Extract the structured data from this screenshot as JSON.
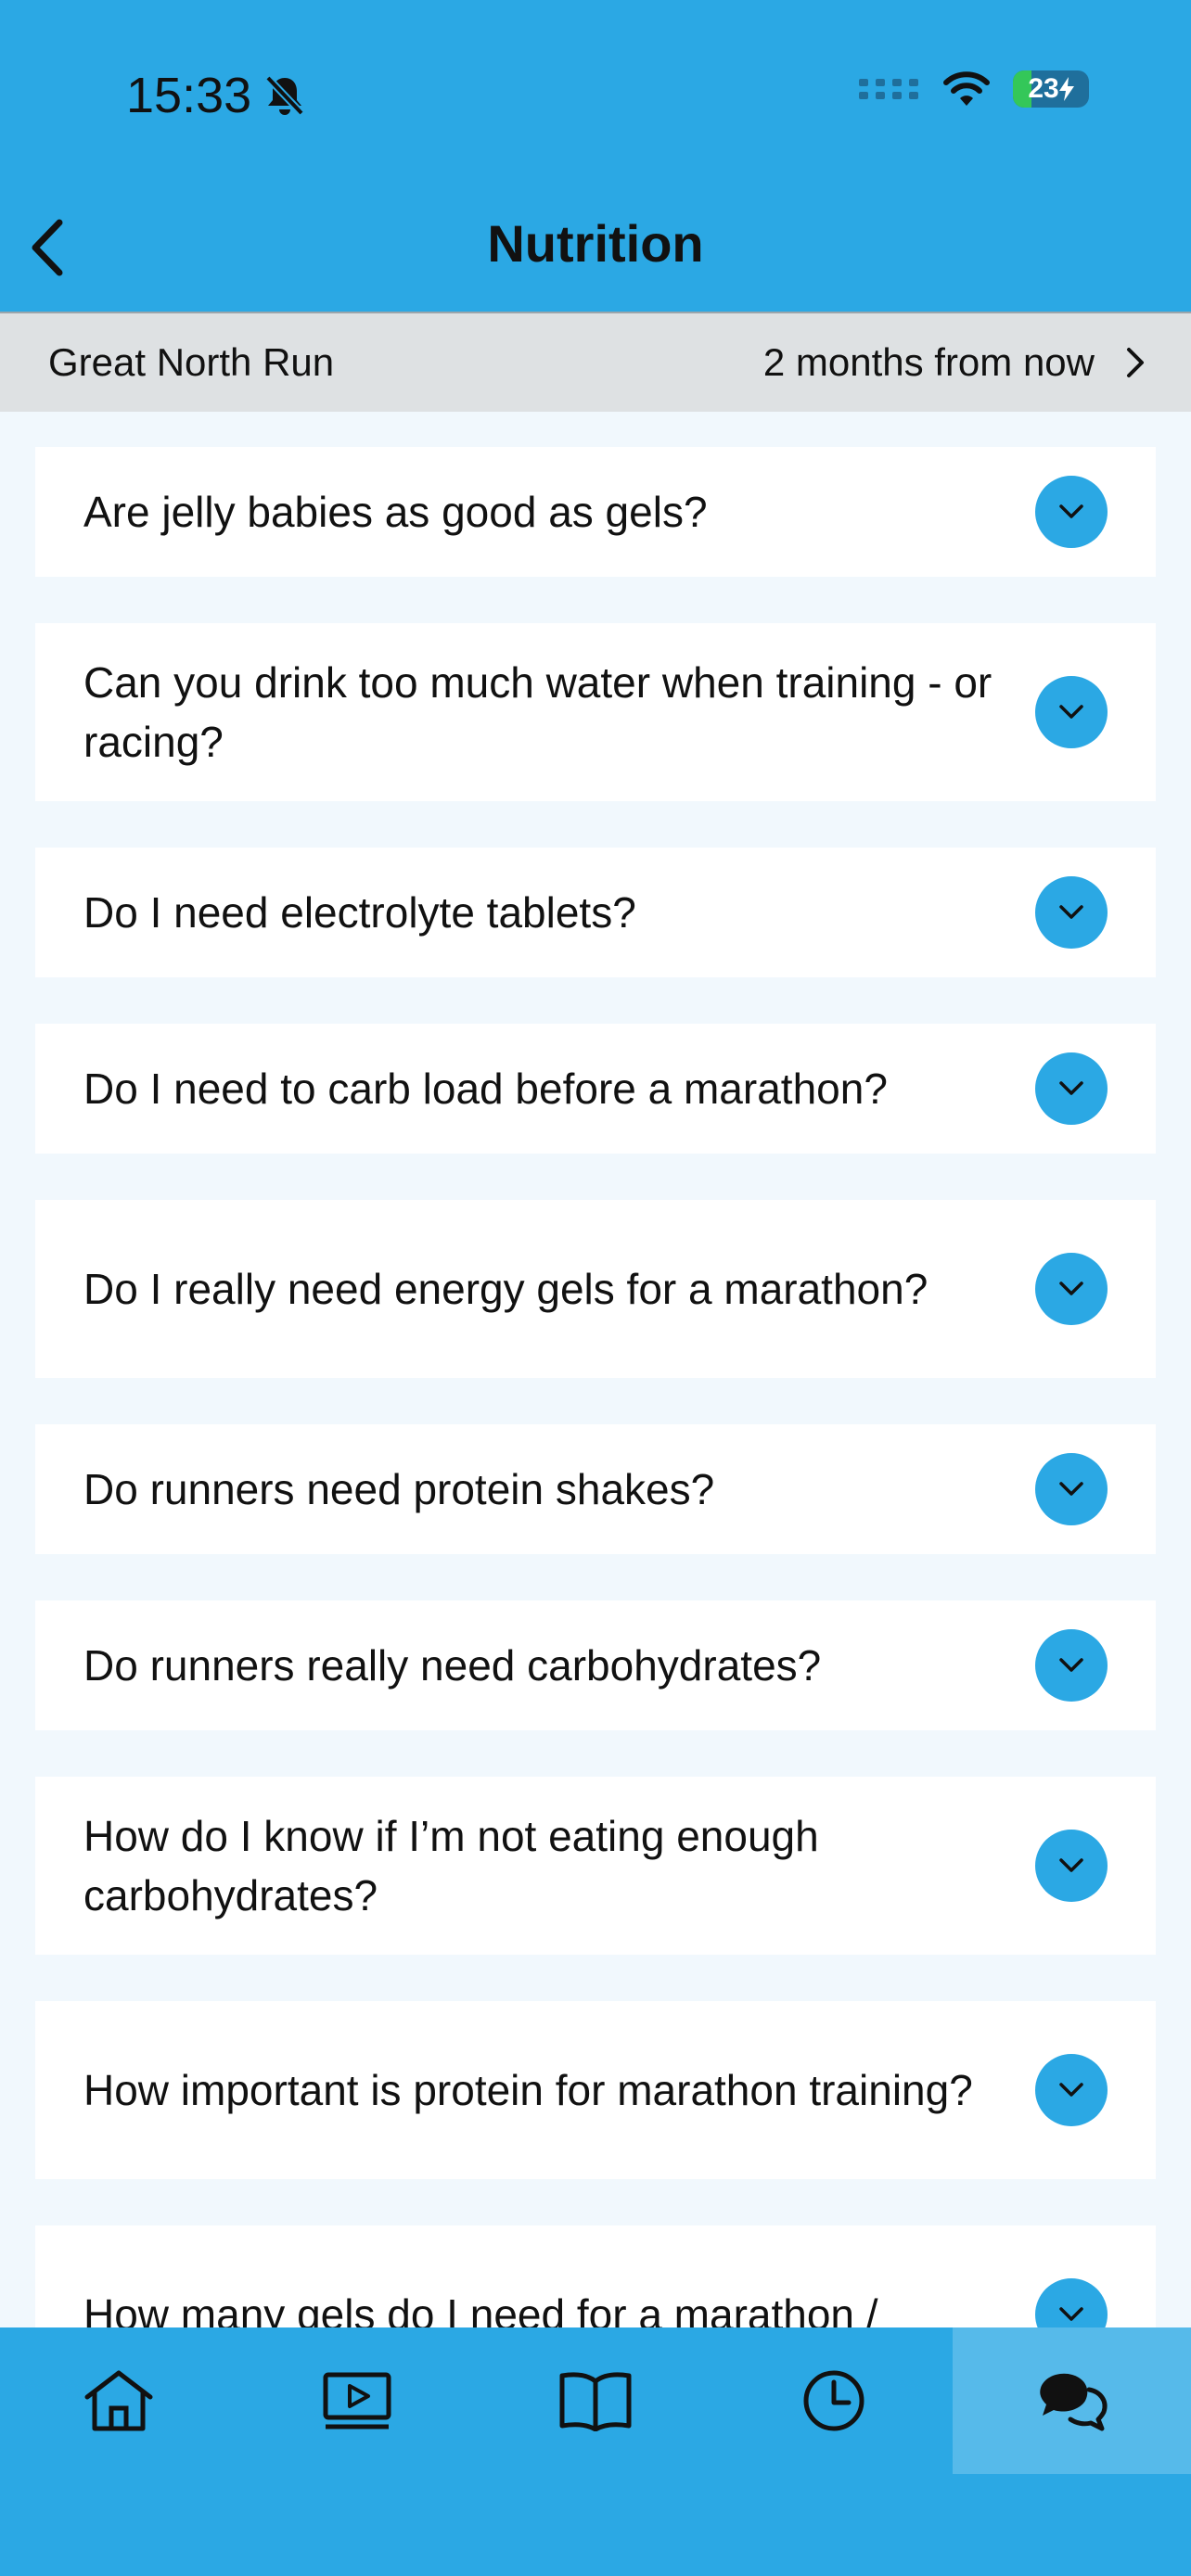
{
  "status": {
    "time": "15:33",
    "battery": "23"
  },
  "nav": {
    "title": "Nutrition"
  },
  "event": {
    "name": "Great North Run",
    "when": "2 months from now"
  },
  "faqs": [
    {
      "question": "Are jelly babies as good as gels?"
    },
    {
      "question": "Can you drink too much water when training - or racing?"
    },
    {
      "question": "Do I need electrolyte tablets?"
    },
    {
      "question": "Do I need to carb load before a marathon?"
    },
    {
      "question": "Do I really need energy gels for a marathon?"
    },
    {
      "question": "Do runners need protein shakes?"
    },
    {
      "question": "Do runners really need carbohydrates?"
    },
    {
      "question": "How do I know if I’m not eating enough carbohydrates?"
    },
    {
      "question": "How important is protein for marathon training?"
    },
    {
      "question": "How many gels do I need for a marathon /"
    }
  ],
  "tabs": [
    {
      "icon": "home-icon"
    },
    {
      "icon": "video-icon"
    },
    {
      "icon": "book-icon"
    },
    {
      "icon": "clock-icon"
    },
    {
      "icon": "chat-icon",
      "active": true
    }
  ],
  "colors": {
    "brand": "#2ba8e4",
    "active_tab": "#56baea",
    "background": "#f1f8fd",
    "event_bar": "#dee1e3"
  }
}
